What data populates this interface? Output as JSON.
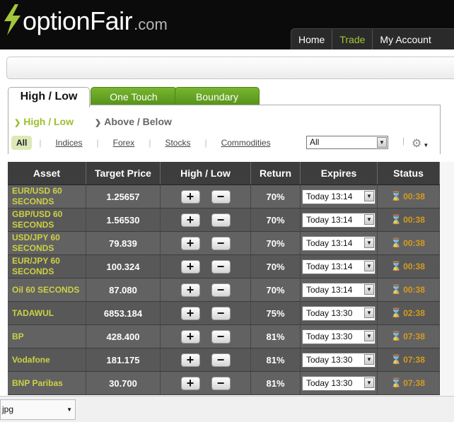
{
  "brand": {
    "name": "optionFair",
    "domain": ".com",
    "logo_color": "#a3c63b"
  },
  "topnav": [
    "Home",
    "Trade",
    "My Account"
  ],
  "tabs": [
    "High / Low",
    "One Touch",
    "Boundary"
  ],
  "subtabs": [
    "High / Low",
    "Above / Below"
  ],
  "filters": {
    "all": "All",
    "links": [
      "Indices",
      "Forex",
      "Stocks",
      "Commodities"
    ],
    "select": "All"
  },
  "table": {
    "headers": [
      "Asset",
      "Target Price",
      "High / Low",
      "Return",
      "Expires",
      "Status"
    ],
    "rows": [
      {
        "asset": "EUR/USD 60 SECONDS",
        "price": "1.25657",
        "ret": "70%",
        "exp": "Today 13:14",
        "status": "00:38"
      },
      {
        "asset": "GBP/USD 60 SECONDS",
        "price": "1.56530",
        "ret": "70%",
        "exp": "Today 13:14",
        "status": "00:38"
      },
      {
        "asset": "USD/JPY 60 SECONDS",
        "price": "79.839",
        "ret": "70%",
        "exp": "Today 13:14",
        "status": "00:38"
      },
      {
        "asset": "EUR/JPY 60 SECONDS",
        "price": "100.324",
        "ret": "70%",
        "exp": "Today 13:14",
        "status": "00:38"
      },
      {
        "asset": "Oil 60 SECONDS",
        "price": "87.080",
        "ret": "70%",
        "exp": "Today 13:14",
        "status": "00:38"
      },
      {
        "asset": "TADAWUL",
        "price": "6853.184",
        "ret": "75%",
        "exp": "Today 13:30",
        "status": "02:38"
      },
      {
        "asset": "BP",
        "price": "428.400",
        "ret": "81%",
        "exp": "Today 13:30",
        "status": "07:38"
      },
      {
        "asset": "Vodafone",
        "price": "181.175",
        "ret": "81%",
        "exp": "Today 13:30",
        "status": "07:38"
      },
      {
        "asset": "BNP Paribas",
        "price": "30.700",
        "ret": "81%",
        "exp": "Today 13:30",
        "status": "07:38"
      }
    ]
  },
  "download": {
    "file": "jpg"
  }
}
